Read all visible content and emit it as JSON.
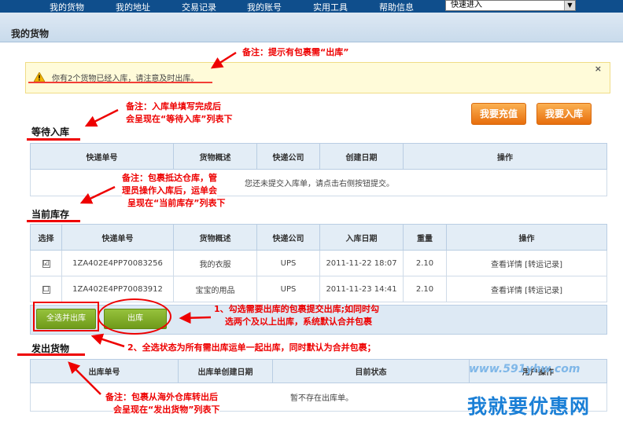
{
  "nav": {
    "items": [
      "我的货物",
      "我的地址",
      "交易记录",
      "我的账号",
      "实用工具",
      "帮助信息"
    ],
    "quick_select": "快速进入"
  },
  "page_title": "我的货物",
  "notice": {
    "text": "你有2个货物已经入库，请注意及时出库。",
    "close": "×"
  },
  "buttons": {
    "recharge": "我要充值",
    "instock": "我要入库",
    "select_all": "全选并出库",
    "outbound": "出库"
  },
  "sections": {
    "waiting": "等待入库",
    "current": "当前库存",
    "shipped": "发出货物"
  },
  "waiting_table": {
    "headers": [
      "快递单号",
      "货物概述",
      "快递公司",
      "创建日期",
      "操作"
    ],
    "empty": "您还未提交入库单，请点击右侧按钮提交。"
  },
  "stock_table": {
    "headers": [
      "选择",
      "快递单号",
      "货物概述",
      "快递公司",
      "入库日期",
      "重量",
      "操作"
    ],
    "rows": [
      {
        "checked": "☑",
        "tracking": "1ZA402E4PP70083256",
        "desc": "我的衣服",
        "carrier": "UPS",
        "date": "2011-11-22 18:07",
        "weight": "2.10",
        "ops": "查看详情 [转运记录]"
      },
      {
        "checked": "☐",
        "tracking": "1ZA402E4PP70083912",
        "desc": "宝宝的用品",
        "carrier": "UPS",
        "date": "2011-11-23 14:41",
        "weight": "2.10",
        "ops": "查看详情 [转运记录]"
      }
    ]
  },
  "shipped_table": {
    "headers": [
      "出库单号",
      "出库单创建日期",
      "目前状态",
      "用户操作"
    ],
    "empty": "暂不存在出库单。"
  },
  "notes": {
    "n1": "备注：提示有包裹需“出库”",
    "n2a": "备注：入库单填写完成后",
    "n2b": "会呈现在“等待入库”列表下",
    "n3a": "备注：包裹抵达仓库，管",
    "n3b": "理员操作入库后，运单会",
    "n3c": "呈现在“当前库存”列表下",
    "n4a": "1、勾选需要出库的包裹提交出库;如同时勾",
    "n4b": "选两个及以上出库，系统默认合并包裹",
    "n5": "2、全选状态为所有需出库运单一起出库，同时默认为合并包裹；",
    "n6a": "备注：包裹从海外仓库转出后",
    "n6b": "会呈现在“发出货物”列表下"
  },
  "watermark": {
    "url": "www.591yhw.com",
    "name": "我就要优惠网"
  },
  "colors": {
    "nav_bg": "#0f4e8c",
    "annotation_red": "#e00000",
    "orange_button": "#e76d0c",
    "green_button": "#7ba323"
  }
}
